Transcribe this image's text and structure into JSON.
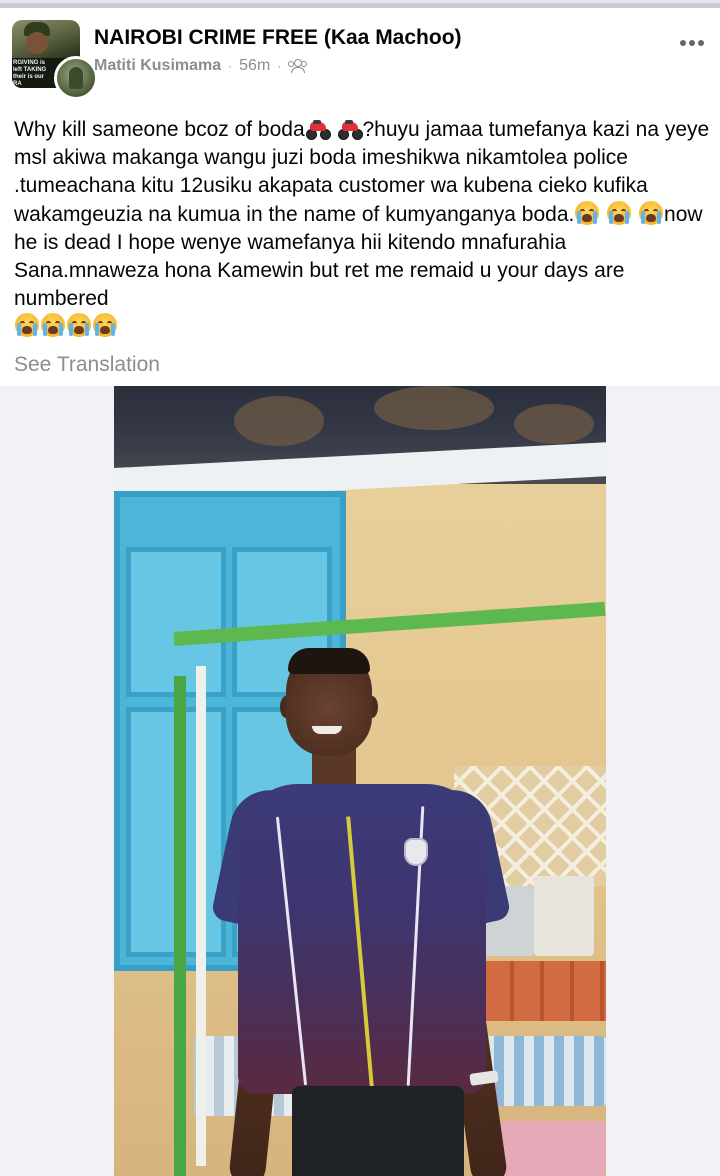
{
  "post": {
    "group_name": "NAIROBI CRIME FREE (Kaa Machoo)",
    "author": "Matiti Kusimama",
    "time": "56m",
    "separator": "·",
    "privacy_icon": "members-icon",
    "more_icon": "more-horizontal-icon",
    "group_avatar_caption": "RGIVING is left TAKING their is our RA",
    "text_parts": {
      "p1": "Why kill sameone bcoz of boda",
      "p2": "?huyu jamaa tumefanya kazi na yeye msl akiwa makanga wangu juzi boda imeshikwa nikamtolea police .tumeachana kitu 12usiku akapata customer wa kubena cieko kufika wakamgeuzia na kumua in the name of kumyanganya boda.",
      "p3": "now he is dead I hope wenye wamefanya hii kitendo mnafurahia Sana.mnaweza hona Kamewin but ret me remaid u your days are numbered"
    },
    "emojis": {
      "after_p1": [
        "motorcycle",
        "motorcycle"
      ],
      "after_p2": [
        "loudly-crying-face",
        "loudly-crying-face",
        "loudly-crying-face"
      ],
      "after_p3": [
        "loudly-crying-face",
        "loudly-crying-face",
        "loudly-crying-face",
        "loudly-crying-face"
      ]
    },
    "see_translation": "See Translation"
  },
  "colors": {
    "text": "#050505",
    "secondary": "#8a8d91",
    "icon": "#65676b",
    "photo_background": "#f0f2f5"
  }
}
